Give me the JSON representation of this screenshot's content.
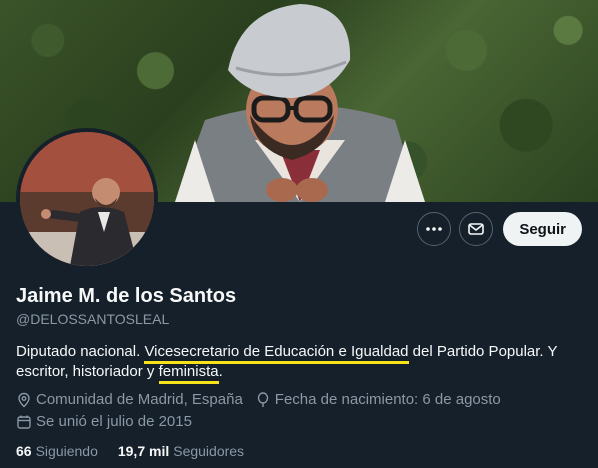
{
  "profile": {
    "name": "Jaime M. de los Santos",
    "handle": "@DELOSSANTOSLEAL",
    "bio": {
      "part1": "Diputado nacional. ",
      "highlight1": "Vicesecretario de Educación e Igualdad",
      "part2": " del Partido Popular. Y escritor, historiador y ",
      "highlight2": "feminista",
      "part3": "."
    },
    "location": "Comunidad de Madrid, España",
    "birthday": "Fecha de nacimiento: 6 de agosto",
    "joined": "Se unió el julio de 2015"
  },
  "actions": {
    "more_icon": "more-icon",
    "message_icon": "mail-icon",
    "follow_label": "Seguir"
  },
  "stats": {
    "following_count": "66",
    "following_label": "Siguiendo",
    "followers_count": "19,7 mil",
    "followers_label": "Seguidores"
  },
  "colors": {
    "background": "#15202b",
    "highlight_underline": "#f8e21a",
    "secondary_text": "#8b98a5"
  }
}
